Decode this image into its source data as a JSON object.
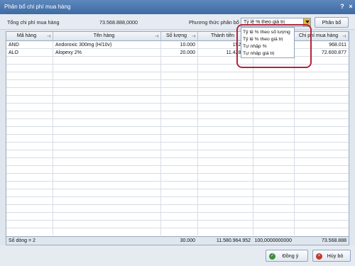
{
  "window": {
    "title": "Phân bổ chi phí mua hàng",
    "help": "?",
    "close": "×"
  },
  "top": {
    "total_label": "Tổng chi phí mua hàng",
    "total_value": "73.568.888,0000",
    "method_label": "Phương thức phân bổ",
    "method_value": "Tỷ lệ % theo giá trị",
    "allocate_button": "Phân bổ"
  },
  "dropdown": {
    "options": [
      "Tỷ lệ % theo số lượng",
      "Tỷ lệ % theo giá trị",
      "Tự nhập %",
      "Tự nhập giá trị"
    ]
  },
  "grid": {
    "columns": [
      "Mã hàng",
      "Tên hàng",
      "Số lượng",
      "Thành tiền",
      "",
      "Chi phí mua hàng"
    ],
    "rows": [
      {
        "code": "AND",
        "name": "Andoroxic 300mg (H/10v)",
        "qty": "10.000",
        "amount": "152.380",
        "pct": "",
        "cost": "968.011"
      },
      {
        "code": "ALO",
        "name": "Alopexy 2%",
        "qty": "20.000",
        "amount": "11.428.584",
        "pct": "",
        "cost": "72.600.877"
      }
    ],
    "footer": {
      "count": "Số dòng = 2",
      "qty": "30.000",
      "amount": "11.580.964.952",
      "pct": "100,0000000000",
      "cost": "73.568.888"
    }
  },
  "buttons": {
    "ok": "Đồng ý",
    "cancel": "Hủy bỏ"
  },
  "colors": {
    "title_bar": "#3e6aa3",
    "highlight": "#b5233a",
    "ok_icon": "#3a8f3a",
    "cancel_icon": "#c0392b"
  }
}
